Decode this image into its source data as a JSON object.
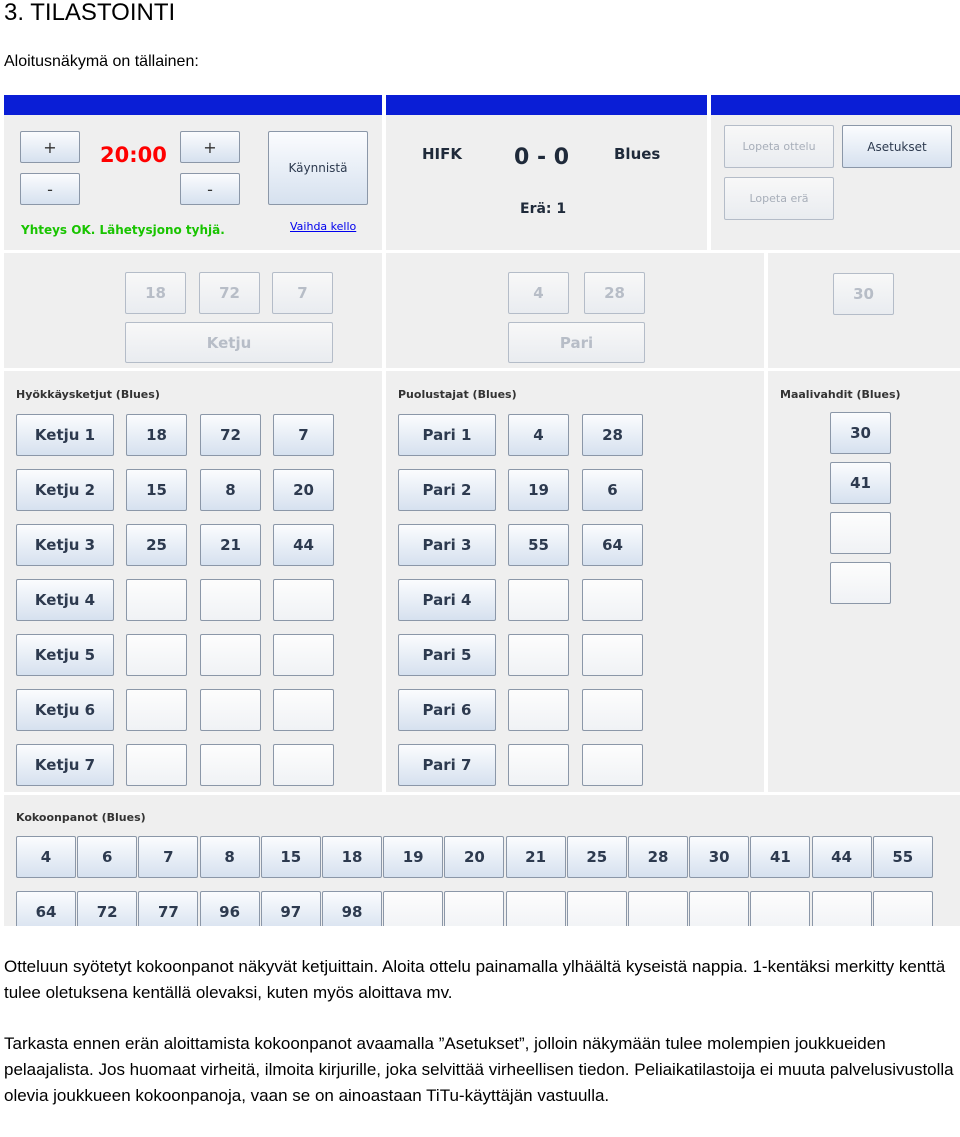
{
  "document": {
    "heading": "3. TILASTOINTI",
    "intro": "Aloitusnäkymä on tällainen:",
    "paragraph1": "Otteluun syötetyt kokoonpanot näkyvät ketjuittain. Aloita ottelu painamalla ylhäältä kyseistä nappia. 1-kentäksi merkitty kenttä tulee oletuksena kentällä olevaksi, kuten myös aloittava mv.",
    "paragraph2": "Tarkasta ennen erän aloittamista kokoonpanot avaamalla ”Asetukset”, jolloin näkymään tulee molempien joukkueiden pelaajalista. Jos huomaat virheitä, ilmoita kirjurille, joka selvittää virheellisen tiedon. Peliaikatilastoija ei muuta palvelusivustolla olevia joukkueen kokoonpanoja, vaan se on ainoastaan TiTu-käyttäjän vastuulla."
  },
  "app": {
    "clock": {
      "plus_left": "+",
      "minus_left": "-",
      "plus_right": "+",
      "minus_right": "-",
      "time": "20:00",
      "start_label": "Käynnistä",
      "status": "Yhteys OK. Lähetysjono tyhjä.",
      "change_clock_link": "Vaihda kello"
    },
    "scoreboard": {
      "home_team": "HIFK",
      "score": "0 - 0",
      "away_team": "Blues",
      "period": "Erä: 1"
    },
    "match_controls": {
      "end_match": "Lopeta ottelu",
      "settings": "Asetukset",
      "end_period": "Lopeta erä"
    },
    "current_line": {
      "players": [
        "18",
        "72",
        "7"
      ],
      "label": "Ketju"
    },
    "current_pair": {
      "players": [
        "4",
        "28"
      ],
      "label": "Pari"
    },
    "current_goalie": "30",
    "forwards": {
      "title": "Hyökkäysketjut (Blues)",
      "lines": [
        {
          "label": "Ketju 1",
          "players": [
            "18",
            "72",
            "7"
          ]
        },
        {
          "label": "Ketju 2",
          "players": [
            "15",
            "8",
            "20"
          ]
        },
        {
          "label": "Ketju 3",
          "players": [
            "25",
            "21",
            "44"
          ]
        },
        {
          "label": "Ketju 4",
          "players": [
            "",
            "",
            ""
          ]
        },
        {
          "label": "Ketju 5",
          "players": [
            "",
            "",
            ""
          ]
        },
        {
          "label": "Ketju 6",
          "players": [
            "",
            "",
            ""
          ]
        },
        {
          "label": "Ketju 7",
          "players": [
            "",
            "",
            ""
          ]
        }
      ]
    },
    "defense": {
      "title": "Puolustajat (Blues)",
      "pairs": [
        {
          "label": "Pari 1",
          "players": [
            "4",
            "28"
          ]
        },
        {
          "label": "Pari 2",
          "players": [
            "19",
            "6"
          ]
        },
        {
          "label": "Pari 3",
          "players": [
            "55",
            "64"
          ]
        },
        {
          "label": "Pari 4",
          "players": [
            "",
            ""
          ]
        },
        {
          "label": "Pari 5",
          "players": [
            "",
            ""
          ]
        },
        {
          "label": "Pari 6",
          "players": [
            "",
            ""
          ]
        },
        {
          "label": "Pari 7",
          "players": [
            "",
            ""
          ]
        }
      ]
    },
    "goalies": {
      "title": "Maalivahdit (Blues)",
      "players": [
        "30",
        "41",
        "",
        ""
      ]
    },
    "roster": {
      "title": "Kokoonpanot (Blues)",
      "row1": [
        "4",
        "6",
        "7",
        "8",
        "15",
        "18",
        "19",
        "20",
        "21",
        "25",
        "28",
        "30",
        "41",
        "44",
        "55"
      ],
      "row2": [
        "64",
        "72",
        "77",
        "96",
        "97",
        "98",
        "",
        "",
        "",
        "",
        "",
        "",
        "",
        "",
        ""
      ]
    }
  }
}
